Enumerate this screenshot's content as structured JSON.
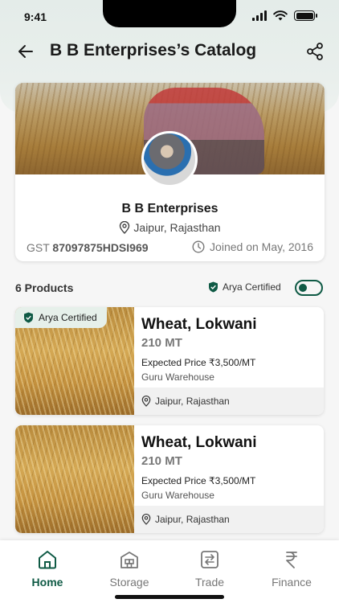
{
  "status_bar": {
    "time": "9:41"
  },
  "header": {
    "title": "B B Enterprises’s Catalog"
  },
  "profile": {
    "name": "B B Enterprises",
    "location": "Jaipur, Rajasthan",
    "gst_label": "GST",
    "gst_number": "87097875HDSI969",
    "joined": "Joined on May, 2016"
  },
  "products_header": {
    "count_label": "6 Products",
    "filter_label": "Arya Certified",
    "filter_on": true
  },
  "products": [
    {
      "badge": "Arya Certified",
      "name": "Wheat, Lokwani",
      "quantity": "210 MT",
      "price": "Expected Price ₹3,500/MT",
      "warehouse": "Guru Warehouse",
      "location": "Jaipur, Rajasthan"
    },
    {
      "name": "Wheat, Lokwani",
      "quantity": "210 MT",
      "price": "Expected Price ₹3,500/MT",
      "warehouse": "Guru Warehouse",
      "location": "Jaipur, Rajasthan"
    }
  ],
  "nav": [
    {
      "label": "Home",
      "icon": "home-icon",
      "active": true
    },
    {
      "label": "Storage",
      "icon": "storage-icon",
      "active": false
    },
    {
      "label": "Trade",
      "icon": "trade-icon",
      "active": false
    },
    {
      "label": "Finance",
      "icon": "rupee-icon",
      "active": false
    }
  ],
  "colors": {
    "accent": "#0f5a45",
    "badge_bg": "#e6f0ea"
  }
}
